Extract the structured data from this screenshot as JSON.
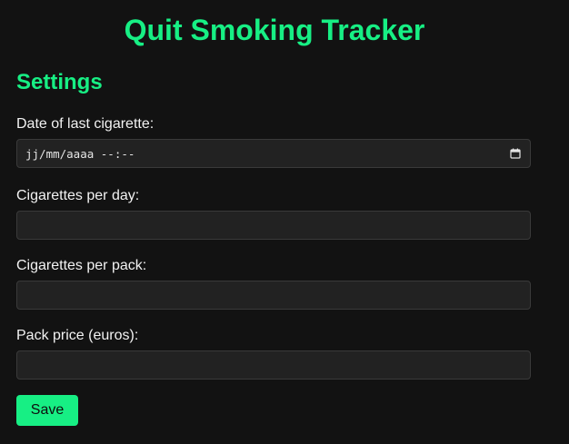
{
  "app": {
    "title": "Quit Smoking Tracker"
  },
  "settings": {
    "title": "Settings",
    "fields": [
      {
        "label": "Date of last cigarette:",
        "type": "datetime",
        "value": "",
        "placeholder": "jj/mm/aaaa --:--",
        "icon": "calendar-icon"
      },
      {
        "label": "Cigarettes per day:",
        "type": "number",
        "value": ""
      },
      {
        "label": "Cigarettes per pack:",
        "type": "number",
        "value": ""
      },
      {
        "label": "Pack price (euros):",
        "type": "number",
        "value": ""
      }
    ],
    "save_label": "Save"
  },
  "colors": {
    "background": "#121212",
    "accent": "#17ef84",
    "input_background": "#222222",
    "input_border": "#3a3a3a",
    "text": "#f2f2f2"
  }
}
